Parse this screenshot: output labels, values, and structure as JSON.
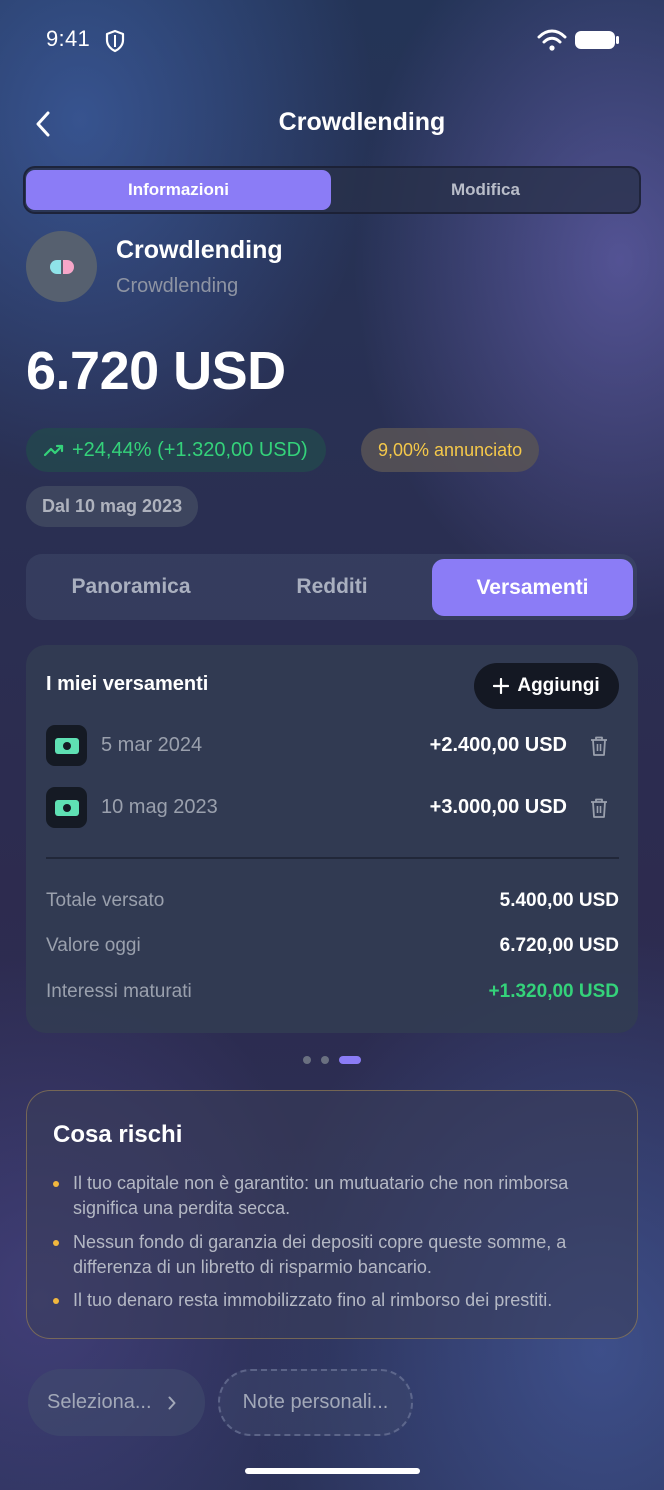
{
  "status_bar": {
    "time": "9:41"
  },
  "header": {
    "title": "Crowdlending"
  },
  "top_tabs": {
    "active": "Informazioni",
    "inactive": "Modifica"
  },
  "asset": {
    "name": "Crowdlending",
    "subtitle": "Crowdlending"
  },
  "amount": "6.720 USD",
  "performance": "+24,44% (+1.320,00 USD)",
  "announced_rate": "9,00% annunciato",
  "since_date": "Dal 10 mag 2023",
  "section_tabs": [
    {
      "label": "Panoramica",
      "active": false
    },
    {
      "label": "Redditi",
      "active": false
    },
    {
      "label": "Versamenti",
      "active": true
    }
  ],
  "deposits_card": {
    "title": "I miei versamenti",
    "add_label": "Aggiungi",
    "items": [
      {
        "date": "5 mar 2024",
        "amount": "+2.400,00 USD"
      },
      {
        "date": "10 mag 2023",
        "amount": "+3.000,00 USD"
      }
    ],
    "summary": [
      {
        "label": "Totale versato",
        "value": "5.400,00 USD"
      },
      {
        "label": "Valore oggi",
        "value": "6.720,00 USD"
      },
      {
        "label": "Interessi maturati",
        "value": "+1.320,00 USD"
      }
    ]
  },
  "pager": {
    "count": 3,
    "active_index": 2
  },
  "risks": {
    "title": "Cosa rischi",
    "items": [
      "Il tuo capitale non è garantito: un mutuatario che non rimborsa significa una perdita secca.",
      "Nessun fondo di garanzia dei depositi copre queste somme, a differenza di un libretto di risparmio bancario.",
      "Il tuo denaro resta immobilizzato fino al rimborso dei prestiti."
    ]
  },
  "bottom": {
    "select_label": "Seleziona...",
    "note_label": "Note personali..."
  },
  "colors": {
    "accent": "#8b7cf6",
    "positive": "#34d27a",
    "warning": "#f4c84a"
  }
}
